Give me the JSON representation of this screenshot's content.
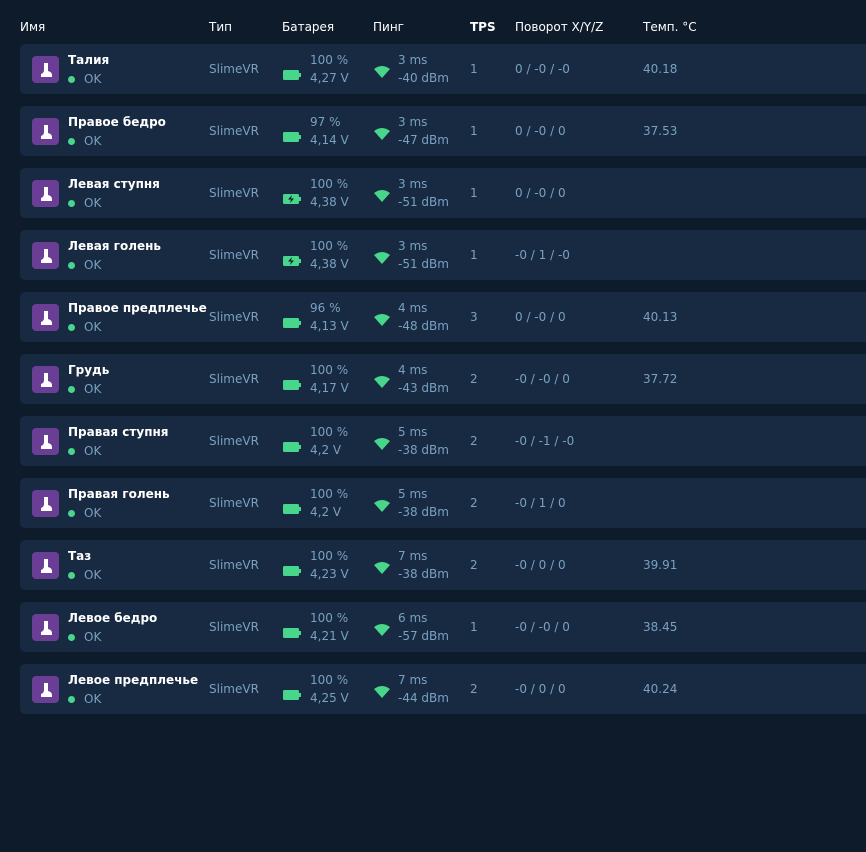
{
  "header": {
    "name": "Имя",
    "type": "Тип",
    "battery": "Батарея",
    "ping": "Пинг",
    "tps": "TPS",
    "rotation": "Поворот X/Y/Z",
    "temp": "Темп. °C"
  },
  "colors": {
    "accent": "#47d68c",
    "icon_bg": "#6a3e95",
    "row_bg": "#172a41",
    "page_bg": "#0e1b2b"
  },
  "trackers": [
    {
      "name": "Талия",
      "status": "OK",
      "type": "SlimeVR",
      "battery_pct": "100 %",
      "voltage": "4,27 V",
      "charging": false,
      "ping": "3 ms",
      "rssi": "-40 dBm",
      "tps": "1",
      "rotation": "0 / -0 / -0",
      "temp": "40.18"
    },
    {
      "name": "Правое бедро",
      "status": "OK",
      "type": "SlimeVR",
      "battery_pct": "97 %",
      "voltage": "4,14 V",
      "charging": false,
      "ping": "3 ms",
      "rssi": "-47 dBm",
      "tps": "1",
      "rotation": "0 / -0 / 0",
      "temp": "37.53"
    },
    {
      "name": "Левая ступня",
      "status": "OK",
      "type": "SlimeVR",
      "battery_pct": "100 %",
      "voltage": "4,38 V",
      "charging": true,
      "ping": "3 ms",
      "rssi": "-51 dBm",
      "tps": "1",
      "rotation": "0 / -0 / 0",
      "temp": ""
    },
    {
      "name": "Левая голень",
      "status": "OK",
      "type": "SlimeVR",
      "battery_pct": "100 %",
      "voltage": "4,38 V",
      "charging": true,
      "ping": "3 ms",
      "rssi": "-51 dBm",
      "tps": "1",
      "rotation": "-0 / 1 / -0",
      "temp": ""
    },
    {
      "name": "Правое предплечье",
      "status": "OK",
      "type": "SlimeVR",
      "battery_pct": "96 %",
      "voltage": "4,13 V",
      "charging": false,
      "ping": "4 ms",
      "rssi": "-48 dBm",
      "tps": "3",
      "rotation": "0 / -0 / 0",
      "temp": "40.13"
    },
    {
      "name": "Грудь",
      "status": "OK",
      "type": "SlimeVR",
      "battery_pct": "100 %",
      "voltage": "4,17 V",
      "charging": false,
      "ping": "4 ms",
      "rssi": "-43 dBm",
      "tps": "2",
      "rotation": "-0 / -0 / 0",
      "temp": "37.72"
    },
    {
      "name": "Правая ступня",
      "status": "OK",
      "type": "SlimeVR",
      "battery_pct": "100 %",
      "voltage": "4,2 V",
      "charging": false,
      "ping": "5 ms",
      "rssi": "-38 dBm",
      "tps": "2",
      "rotation": "-0 / -1 / -0",
      "temp": ""
    },
    {
      "name": "Правая голень",
      "status": "OK",
      "type": "SlimeVR",
      "battery_pct": "100 %",
      "voltage": "4,2 V",
      "charging": false,
      "ping": "5 ms",
      "rssi": "-38 dBm",
      "tps": "2",
      "rotation": "-0 / 1 / 0",
      "temp": ""
    },
    {
      "name": "Таз",
      "status": "OK",
      "type": "SlimeVR",
      "battery_pct": "100 %",
      "voltage": "4,23 V",
      "charging": false,
      "ping": "7 ms",
      "rssi": "-38 dBm",
      "tps": "2",
      "rotation": "-0 / 0 / 0",
      "temp": "39.91"
    },
    {
      "name": "Левое бедро",
      "status": "OK",
      "type": "SlimeVR",
      "battery_pct": "100 %",
      "voltage": "4,21 V",
      "charging": false,
      "ping": "6 ms",
      "rssi": "-57 dBm",
      "tps": "1",
      "rotation": "-0 / -0 / 0",
      "temp": "38.45"
    },
    {
      "name": "Левое предплечье",
      "status": "OK",
      "type": "SlimeVR",
      "battery_pct": "100 %",
      "voltage": "4,25 V",
      "charging": false,
      "ping": "7 ms",
      "rssi": "-44 dBm",
      "tps": "2",
      "rotation": "-0 / 0 / 0",
      "temp": "40.24"
    }
  ]
}
